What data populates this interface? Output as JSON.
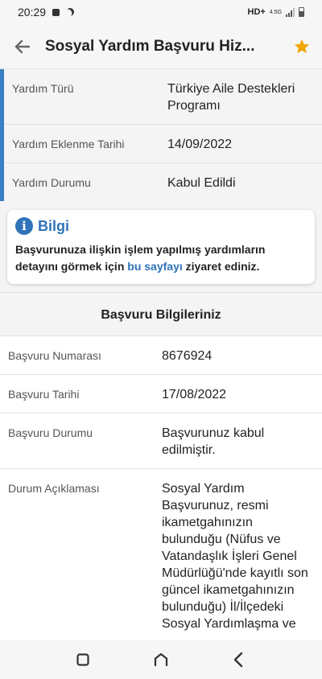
{
  "status_bar": {
    "time": "20:29",
    "network": "HD+",
    "network_type": "4.5G"
  },
  "app_bar": {
    "title": "Sosyal Yardım Başvuru Hiz...",
    "back_icon": "arrow-left-icon",
    "favorite_icon": "star-icon",
    "favorite_color": "#f0a500"
  },
  "summary": {
    "accent_color": "#3a7fc4",
    "rows": [
      {
        "label": "Yardım Türü",
        "value": "Türkiye Aile Destekleri Programı"
      },
      {
        "label": "Yardım Eklenme Tarihi",
        "value": "14/09/2022"
      },
      {
        "label": "Yardım Durumu",
        "value": "Kabul Edildi"
      }
    ]
  },
  "info": {
    "icon": "info-icon",
    "title": "Bilgi",
    "text_before": "Başvurunuza ilişkin işlem yapılmış yardımların detayını görmek için ",
    "link_text": "bu sayfayı",
    "text_after": " ziyaret ediniz.",
    "accent_color": "#2f73b8"
  },
  "section": {
    "title": "Başvuru Bilgileriniz"
  },
  "details": [
    {
      "label": "Başvuru Numarası",
      "value": "8676924"
    },
    {
      "label": "Başvuru Tarihi",
      "value": "17/08/2022"
    },
    {
      "label": "Başvuru Durumu",
      "value": "Başvurunuz kabul edilmiştir."
    },
    {
      "label": "Durum Açıklaması",
      "value": "Sosyal Yardım Başvurunuz, resmi ikametgahınızın bulunduğu (Nüfus ve Vatandaşlık İşleri Genel Müdürlüğü'nde kayıtlı son güncel ikametgahınızın bulunduğu) İl/İlçedeki Sosyal Yardımlaşma ve"
    }
  ],
  "nav_bar": {
    "recents_icon": "recents-icon",
    "home_icon": "home-icon",
    "back_icon": "back-chevron-icon"
  }
}
